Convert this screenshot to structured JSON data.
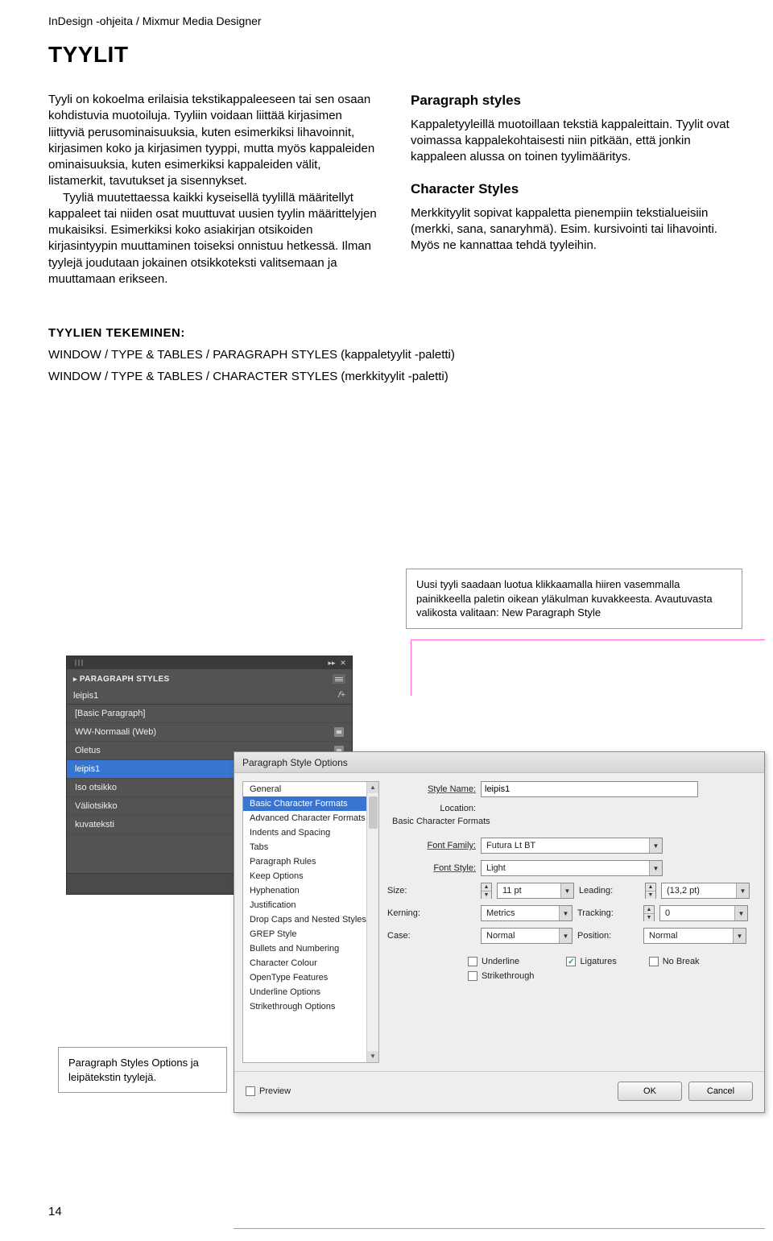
{
  "header": "InDesign -ohjeita / Mixmur Media Designer",
  "h1": "TYYLIT",
  "leftCol": {
    "p1": "Tyyli on kokoelma erilaisia tekstikappaleeseen tai sen osaan kohdistuvia muotoiluja. Tyyliin voidaan liittää kirjasimen liittyviä perusominaisuuksia, kuten esimerkiksi lihavoinnit, kirjasimen koko ja kirjasimen tyyppi, mutta myös kappaleiden ominaisuuksia, kuten esimerkiksi kappaleiden välit, listamerkit, tavutukset ja sisennykset.",
    "p2": "Tyyliä muutettaessa kaikki kyseisellä tyylillä määritellyt kappaleet tai niiden osat muuttuvat uusien tyylin määrittelyjen mukaisiksi. Esimerkiksi koko asiakirjan otsikoiden kirjasintyypin muuttaminen toiseksi onnistuu hetkessä. Ilman tyylejä joudutaan jokainen otsikkoteksti valitsemaan ja muuttamaan erikseen."
  },
  "rightCol": {
    "h2a": "Paragraph styles",
    "pa": "Kappaletyyleillä muotoillaan tekstiä kappaleittain. Tyylit ovat voimassa kappalekohtaisesti niin pitkään, että jonkin kappaleen alussa on toinen tyylimääritys.",
    "h2b": "Character Styles",
    "pb": "Merkkityylit sopivat kappaletta pienempiin tekstialueisiin (merkki, sana, sanaryhmä). Esim. kursivointi tai lihavointi. Myös ne kannattaa tehdä tyyleihin."
  },
  "tyylien": "TYYLIEN TEKEMINEN:",
  "win1": "WINDOW / TYPE & TABLES / PARAGRAPH STYLES (kappaletyylit -paletti)",
  "win2": "WINDOW / TYPE & TABLES / CHARACTER STYLES (merkkityylit -paletti)",
  "noteTop": "Uusi tyyli saadaan luotua klikkaamalla hiiren vasemmalla painikkeella paletin oikean yläkulman kuvakkeesta. Avautuvasta valikosta valitaan: New Paragraph Style",
  "noteLeft": "Paragraph Styles Options ja leipätekstin tyylejä.",
  "psPanel": {
    "title": "PARAGRAPH STYLES",
    "current": "leipis1",
    "rows": [
      {
        "label": "[Basic Paragraph]",
        "disk": false
      },
      {
        "label": "WW-Normaali (Web)",
        "disk": true
      },
      {
        "label": "Oletus",
        "disk": true
      },
      {
        "label": "leipis1",
        "disk": false,
        "selected": true
      },
      {
        "label": "Iso otsikko",
        "disk": false
      },
      {
        "label": "Väliotsikko",
        "disk": false
      },
      {
        "label": "kuvateksti",
        "disk": false
      }
    ]
  },
  "pso": {
    "title": "Paragraph Style Options",
    "categories": [
      "General",
      "Basic Character Formats",
      "Advanced Character Formats",
      "Indents and Spacing",
      "Tabs",
      "Paragraph Rules",
      "Keep Options",
      "Hyphenation",
      "Justification",
      "Drop Caps and Nested Styles",
      "GREP Style",
      "Bullets and Numbering",
      "Character Colour",
      "OpenType Features",
      "Underline Options",
      "Strikethrough Options"
    ],
    "selectedCategoryIndex": 1,
    "labels": {
      "styleName": "Style Name:",
      "location": "Location:",
      "section": "Basic Character Formats",
      "fontFamily": "Font Family:",
      "fontStyle": "Font Style:",
      "size": "Size:",
      "leading": "Leading:",
      "kerning": "Kerning:",
      "tracking": "Tracking:",
      "case": "Case:",
      "position": "Position:",
      "underline": "Underline",
      "strikethrough": "Strikethrough",
      "ligatures": "Ligatures",
      "noBreak": "No Break",
      "preview": "Preview",
      "ok": "OK",
      "cancel": "Cancel"
    },
    "values": {
      "styleName": "leipis1",
      "fontFamily": "Futura Lt BT",
      "fontStyle": "Light",
      "size": "11 pt",
      "leading": "(13,2 pt)",
      "kerning": "Metrics",
      "tracking": "0",
      "case": "Normal",
      "position": "Normal",
      "ligatures": true
    }
  },
  "pageNum": "14"
}
